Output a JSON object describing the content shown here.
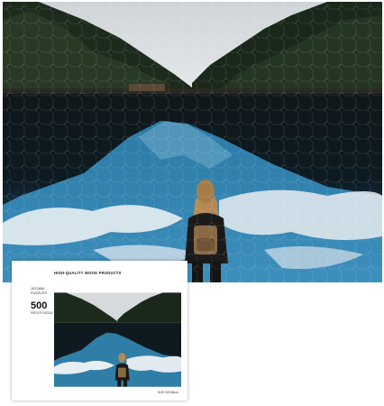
{
  "product": {
    "tagline": "HIGH-QUALITY WOOD PRODUCTS",
    "type_label": "JIGSAW PUZZLES",
    "piece_count": "500",
    "piece_label": "PIECES PUZZLE",
    "size_text": "SIZE 52X38cm"
  },
  "scene": {
    "subject": "woman with backpack at mountain lake",
    "colors": {
      "sky": "#d9dde0",
      "forest": "#1c2a1c",
      "water_dark": "#0c1418",
      "water_blue": "#2f7ea8",
      "snow": "#e8eef2",
      "jacket": "#1a1a1a",
      "hair": "#b38a55",
      "backpack": "#8a6a45"
    }
  }
}
